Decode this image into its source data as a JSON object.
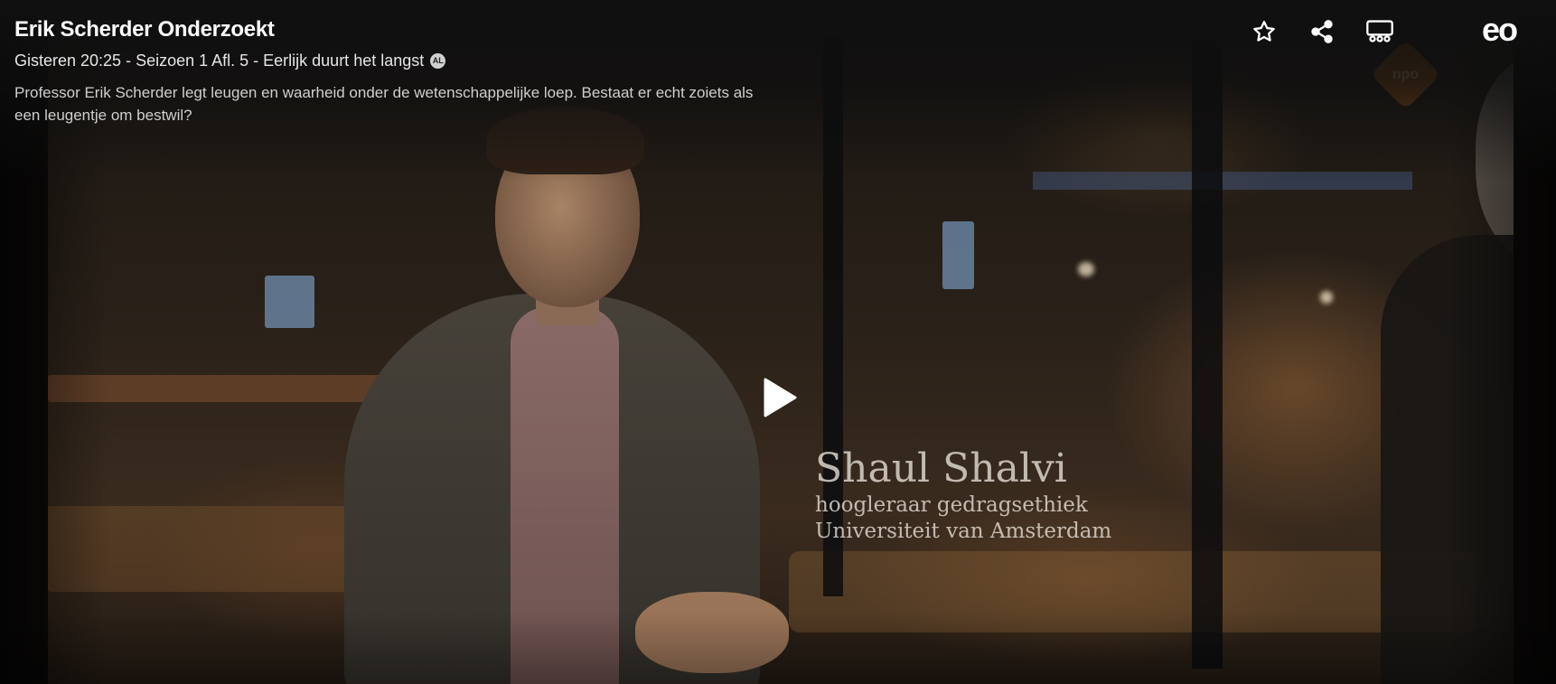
{
  "episode": {
    "title": "Erik Scherder Onderzoekt",
    "meta": "Gisteren 20:25 - Seizoen 1 Afl. 5 - Eerlijk duurt het langst",
    "age_rating": "AL",
    "description": "Professor Erik Scherder legt leugen en waarheid onder de wetenschappelijke loep. Bestaat er echt zoiets als een leugentje om bestwil?"
  },
  "actions": {
    "favorite_icon": "star-icon",
    "share_icon": "share-icon",
    "chromecast_icon": "cast-icon"
  },
  "broadcaster": {
    "logo_text": "eo"
  },
  "watermark": {
    "text": "npo"
  },
  "video_caption": {
    "name": "Shaul Shalvi",
    "title": "hoogleraar gedragsethiek",
    "affiliation": "Universiteit van Amsterdam"
  },
  "player": {
    "play_icon": "play-icon",
    "state": "paused"
  }
}
